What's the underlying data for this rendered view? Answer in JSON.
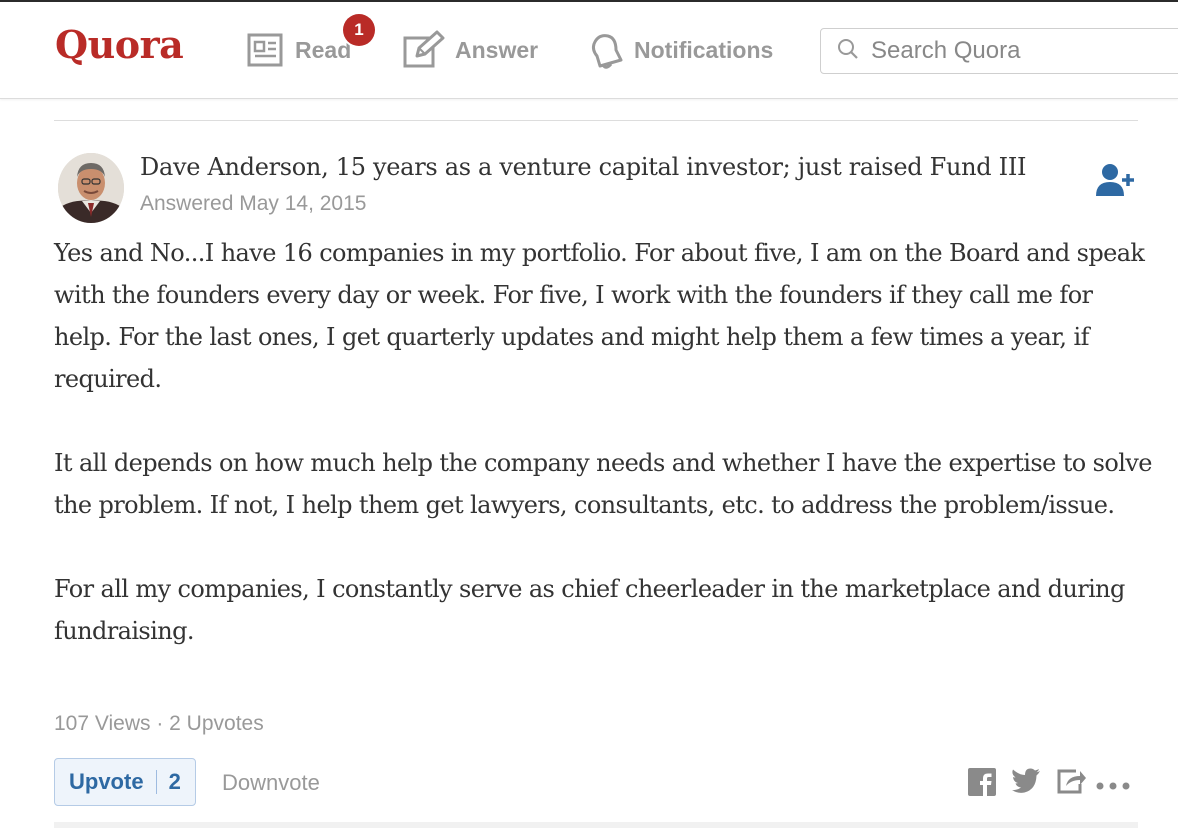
{
  "header": {
    "logo": "Quora",
    "nav": {
      "read": "Read",
      "read_badge": "1",
      "answer": "Answer",
      "notifications": "Notifications"
    },
    "search_placeholder": "Search Quora"
  },
  "answer": {
    "author": "Dave Anderson, 15 years as a venture capital investor; just raised Fund III",
    "answered": "Answered May 14, 2015",
    "paragraphs": [
      "Yes and No...I have 16 companies in my portfolio. For about five, I am on the Board and speak with the founders every day or week. For five, I work with the founders if they call me for help. For the last ones, I get quarterly updates and might help them a few times a year, if required.",
      "It all depends on how much help the company needs and whether I have the expertise to solve the problem. If not, I help them get lawyers, consultants, etc. to address the problem/issue.",
      "For all my companies, I constantly serve as chief cheerleader in the marketplace and during fundraising."
    ],
    "stats": "107 Views · 2 Upvotes"
  },
  "actions": {
    "upvote_label": "Upvote",
    "upvote_count": "2",
    "downvote_label": "Downvote"
  },
  "colors": {
    "brand": "#b92b27",
    "link_blue": "#2e69a3",
    "muted": "#999999"
  },
  "icons": [
    "read-icon",
    "answer-icon",
    "notifications-icon",
    "search-icon",
    "follow-user-icon",
    "facebook-icon",
    "twitter-icon",
    "share-icon",
    "more-icon"
  ]
}
